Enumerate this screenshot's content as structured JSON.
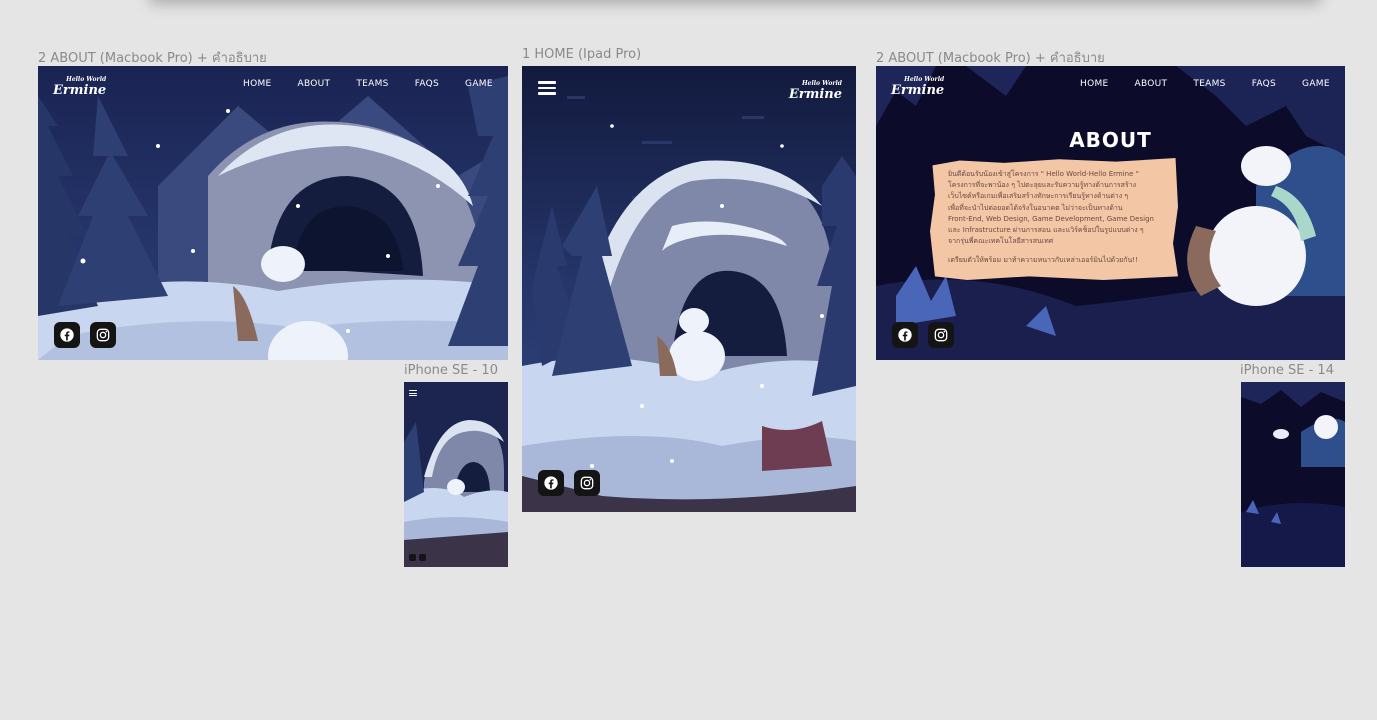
{
  "labels": {
    "frame1": "2 ABOUT (Macbook Pro) + คำอธิบาย",
    "frame2": "1 HOME (Ipad Pro)",
    "frame3": "2 ABOUT (Macbook Pro) + คำอธิบาย",
    "frame4": "iPhone SE - 10",
    "frame5": "iPhone SE - 14"
  },
  "logo": {
    "small": "Hello World",
    "big": "Ermine"
  },
  "nav": [
    "HOME",
    "ABOUT",
    "TEAMS",
    "FAQS",
    "GAME"
  ],
  "about": {
    "title": "ABOUT",
    "paragraph": [
      "ยินดีต้อนรับน้องเข้าสู่โครงการ \" Hello World-Hello Ermine \"",
      "โครงการที่จะพาน้อง ๆ ไปตะลุยและรับความรู้ทางด้านการสร้าง",
      "เว็บไซต์หรือเกมเพื่อเสริมสร้างทักษะการเรียนรู้ทางด้านต่าง ๆ",
      "เพื่อที่จะนำไปต่อยอดได้จริงในอนาคต ไม่ว่าจะเป็นทางด้าน",
      "Front-End, Web Design, Game Development, Game Design",
      "และ Infrastructure ผ่านการสอน และแวิร์คช็อปในรูปแบบต่าง ๆ",
      "จากรุ่นพี่คณะเทคโนโลยีสารสนเทศ"
    ],
    "closing": "เตรียมตัวให้พร้อม มาท้าความหนาวกับเหล่าเออร์มินไปด้วยกัน!!"
  },
  "colors": {
    "canvas": "#e5e5e5",
    "night_sky": "#1b2550",
    "snow": "#c9d6ef",
    "paper": "#f3c6a6",
    "social_bg": "#141414"
  },
  "icons": [
    "facebook-icon",
    "instagram-icon",
    "menu-icon"
  ]
}
